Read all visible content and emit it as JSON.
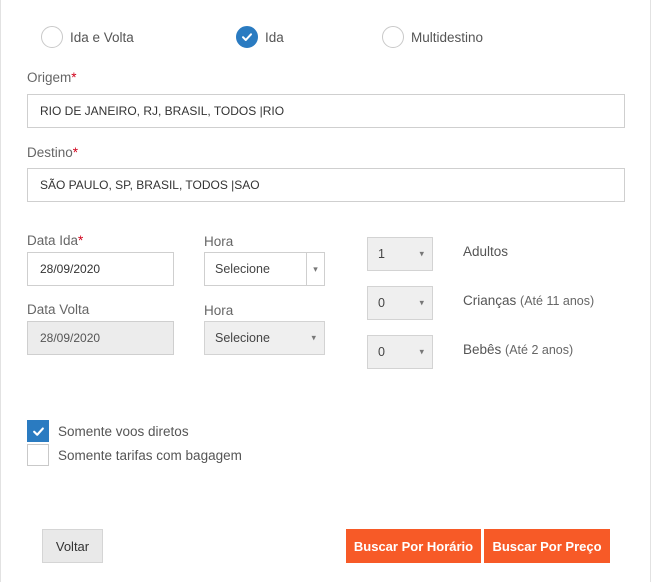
{
  "trip_type": {
    "options": [
      {
        "label": "Ida e Volta",
        "checked": false
      },
      {
        "label": "Ida",
        "checked": true
      },
      {
        "label": "Multidestino",
        "checked": false
      }
    ]
  },
  "origin": {
    "label": "Origem",
    "required_mark": "*",
    "value": "RIO DE JANEIRO, RJ, BRASIL, TODOS |RIO"
  },
  "destination": {
    "label": "Destino",
    "required_mark": "*",
    "value": "SÃO PAULO, SP, BRASIL, TODOS |SAO"
  },
  "departure": {
    "date_label": "Data Ida",
    "required_mark": "*",
    "date_value": "28/09/2020",
    "hour_label": "Hora",
    "hour_value": "Selecione"
  },
  "return": {
    "date_label": "Data Volta",
    "date_value": "28/09/2020",
    "hour_label": "Hora",
    "hour_value": "Selecione"
  },
  "passengers": [
    {
      "count": "1",
      "label": "Adultos",
      "sub": ""
    },
    {
      "count": "0",
      "label": "Crianças",
      "sub": "(Até 11 anos)"
    },
    {
      "count": "0",
      "label": "Bebês",
      "sub": "(Até 2 anos)"
    }
  ],
  "filters": [
    {
      "label": "Somente voos diretos",
      "checked": true
    },
    {
      "label": "Somente tarifas com bagagem",
      "checked": false
    }
  ],
  "buttons": {
    "back": "Voltar",
    "search_time": "Buscar Por Horário",
    "search_price": "Buscar Por Preço"
  },
  "icons": {
    "caret": "▾",
    "check": "check-icon"
  },
  "colors": {
    "accent": "#2a7bc1",
    "primary_button": "#f75a27",
    "required": "#d0021b"
  }
}
